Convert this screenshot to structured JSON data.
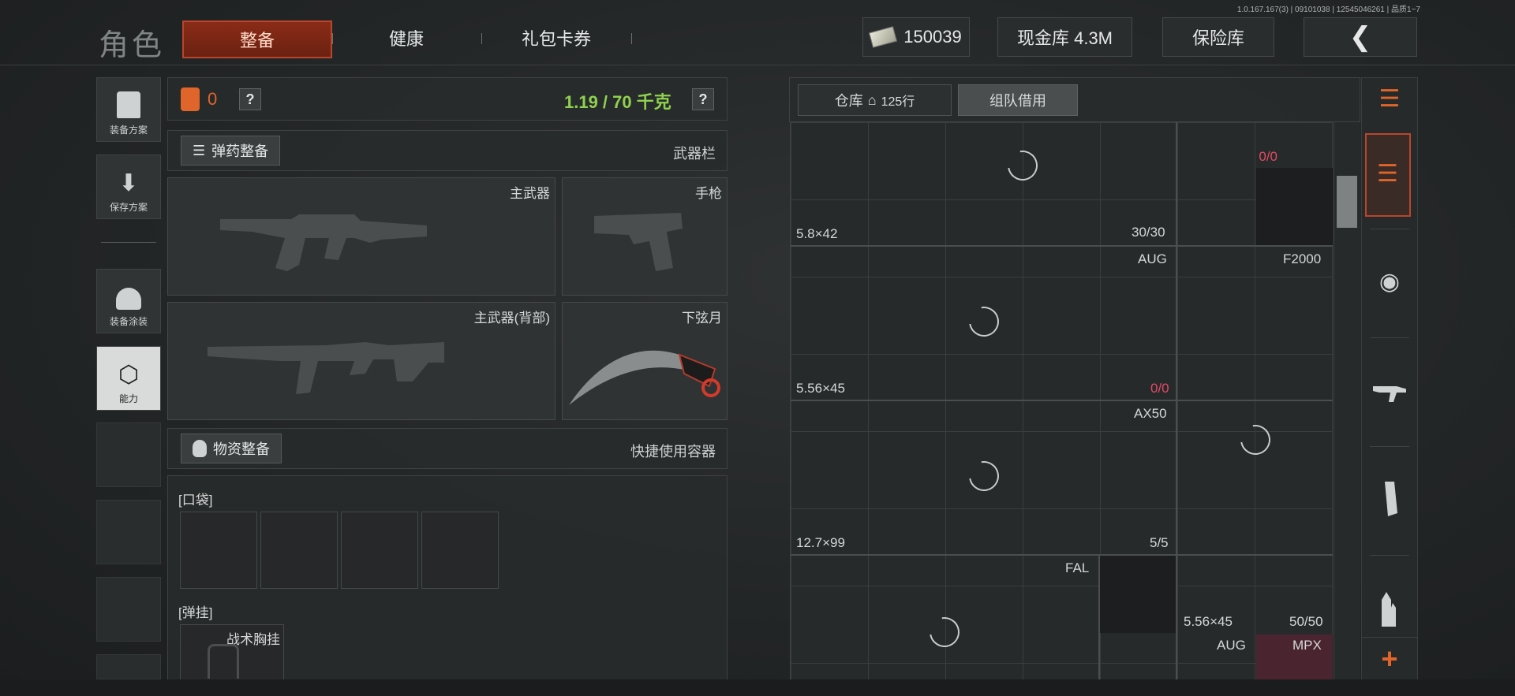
{
  "version": "1.0.167.167(3) | 09101038 | 12545046261 | 品质1~7",
  "header": {
    "title": "角色",
    "tabs": [
      {
        "label": "整备",
        "active": true
      },
      {
        "label": "健康",
        "active": false
      },
      {
        "label": "礼包卡券",
        "active": false
      }
    ],
    "money": "150039",
    "cash_vault": "现金库 4.3M",
    "safe_vault": "保险库"
  },
  "sidebar": {
    "items": [
      {
        "label": "装备方案",
        "icon": "vest-icon"
      },
      {
        "label": "保存方案",
        "icon": "download-icon"
      },
      {
        "label": "装备涂装",
        "icon": "helmet-icon"
      },
      {
        "label": "能力",
        "icon": "lightning-hex-icon",
        "active": true
      }
    ]
  },
  "loadout": {
    "armor_count": "0",
    "weight": "1.19 / 70 千克",
    "ammo_button": "弹药整备",
    "weapons_title": "武器栏",
    "slots": {
      "primary": "主武器",
      "pistol": "手枪",
      "primary_back": "主武器(背部)",
      "melee": "下弦月"
    },
    "supply_button": "物资整备",
    "quick_container": "快捷使用容器",
    "pockets_label": "[口袋]",
    "rig_label": "[弹挂]",
    "rig_item": "战术胸挂"
  },
  "warehouse": {
    "tab_storage": "仓库",
    "rows": "125行",
    "tab_team": "组队借用",
    "cells": [
      {
        "text": "0/0",
        "color": "#e24a63"
      },
      {
        "text": "5.8×42"
      },
      {
        "text": "30/30"
      },
      {
        "text": "AUG"
      },
      {
        "text": "F2000"
      },
      {
        "text": "5.56×45"
      },
      {
        "text": "0/0",
        "color": "#e24a63"
      },
      {
        "text": "AX50"
      },
      {
        "text": "12.7×99"
      },
      {
        "text": "5/5"
      },
      {
        "text": "FAL"
      },
      {
        "text": "5.56×45"
      },
      {
        "text": "50/50"
      },
      {
        "text": "AUG"
      },
      {
        "text": "MPX"
      }
    ]
  },
  "colors": {
    "accent": "#b8452c",
    "weight_green": "#8fd14f",
    "armor_orange": "#e0652a",
    "negative_red": "#e24a63"
  }
}
